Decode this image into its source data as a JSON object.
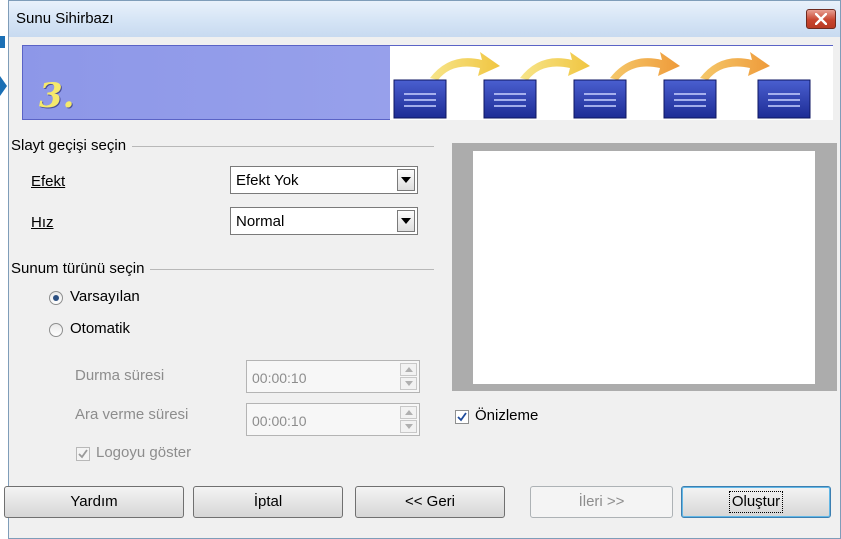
{
  "window": {
    "title": "Sunu Sihirbazı"
  },
  "banner": {
    "step_number": "3.",
    "step_count": 5,
    "colors": {
      "banner_bg": "#9aa3ec",
      "page_icon": "#2f3fa8",
      "arrow": "#f2c94c"
    }
  },
  "transition": {
    "section_title": "Slayt geçişi seçin",
    "effect": {
      "label": "Efekt",
      "value": "Efekt Yok"
    },
    "speed": {
      "label": "Hız",
      "value": "Normal"
    }
  },
  "presentation_type": {
    "section_title": "Sunum türünü seçin",
    "default_option": {
      "label": "Varsayılan",
      "selected": true
    },
    "auto_option": {
      "label": "Otomatik",
      "selected": false
    },
    "pause_duration": {
      "label": "Durma süresi",
      "value": "00:00:10"
    },
    "break_duration": {
      "label": "Ara verme süresi",
      "value": "00:00:10"
    },
    "show_logo": {
      "label": "Logoyu göster",
      "checked": true
    }
  },
  "preview": {
    "checkbox_label": "Önizleme",
    "checked": true
  },
  "buttons": {
    "help": "Yardım",
    "cancel": "İptal",
    "back": "<< Geri",
    "next": "İleri >>",
    "create": "Oluştur"
  },
  "icons": [
    "close-icon",
    "dropdown-arrow-icon",
    "spin-up-icon",
    "spin-down-icon",
    "checkmark-icon",
    "page-icon",
    "arrow-icon"
  ]
}
